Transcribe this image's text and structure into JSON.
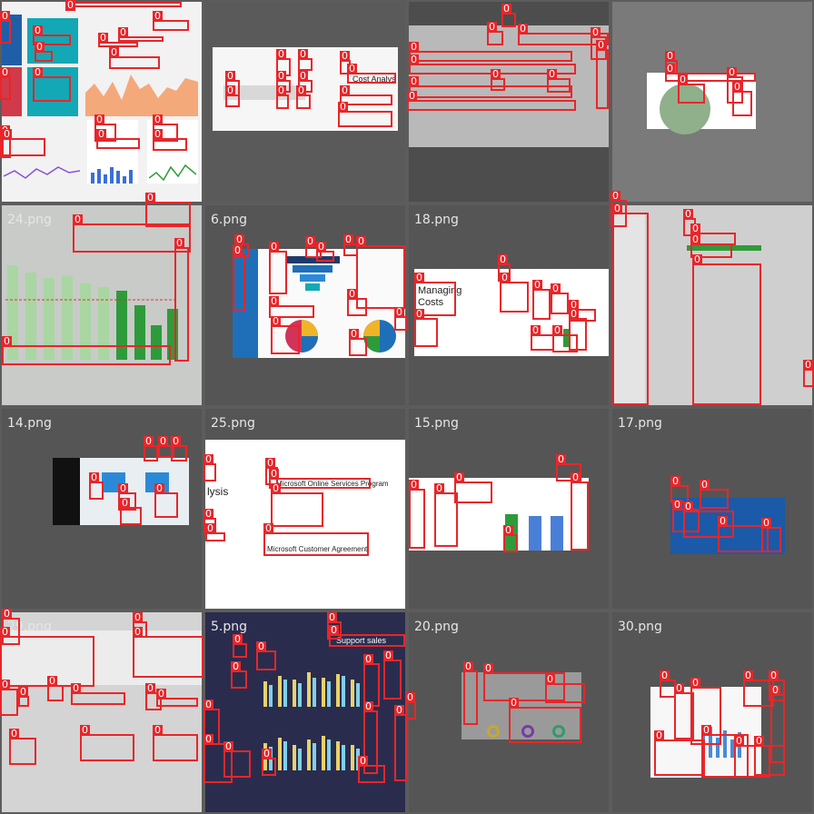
{
  "colors": {
    "tile_bg": "#555555",
    "annotation": "#e8262a",
    "label": "#e6e6e6",
    "green": "#2e9b3a",
    "blue": "#1f6fb8",
    "navy": "#1e2a4a",
    "teal": "#13a8b5"
  },
  "tag_value": "0",
  "tiles": [
    {
      "id": "t00",
      "label": ""
    },
    {
      "id": "t01",
      "label": ""
    },
    {
      "id": "t02",
      "label": ""
    },
    {
      "id": "t03",
      "label": ""
    },
    {
      "id": "t10",
      "label": "24.png"
    },
    {
      "id": "t11",
      "label": "6.png"
    },
    {
      "id": "t12",
      "label": "18.png"
    },
    {
      "id": "t13",
      "label": ""
    },
    {
      "id": "t20",
      "label": "14.png"
    },
    {
      "id": "t21",
      "label": "25.png"
    },
    {
      "id": "t22",
      "label": "15.png"
    },
    {
      "id": "t23",
      "label": "17.png"
    },
    {
      "id": "t30",
      "label": "29.png"
    },
    {
      "id": "t31",
      "label": "5.png"
    },
    {
      "id": "t32",
      "label": "20.png"
    },
    {
      "id": "t33",
      "label": "30.png"
    }
  ],
  "texts": {
    "cost_analysis": "Cost Analys",
    "managing_costs_1": "Managing",
    "managing_costs_2": "Costs",
    "lysis": "lysis",
    "ms_online": "Microsoft Online Services Program",
    "ms_customer": "Microsoft Customer Agreement",
    "sales": "sales",
    "support": "Support"
  }
}
